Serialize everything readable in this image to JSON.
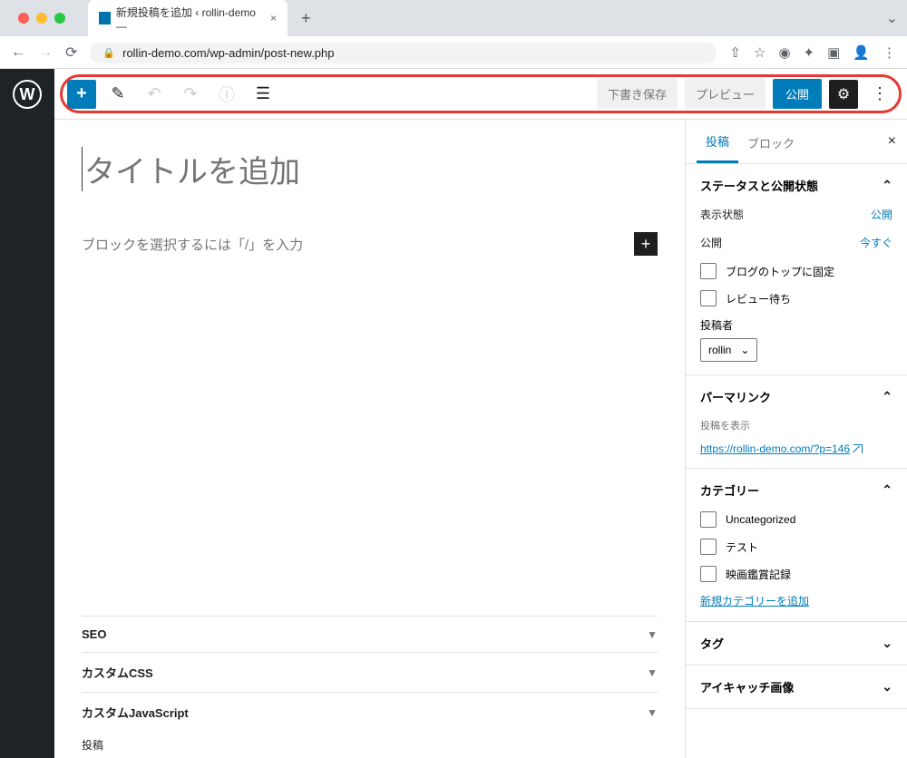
{
  "browser": {
    "tab_title": "新規投稿を追加 ‹ rollin-demo —",
    "url": "rollin-demo.com/wp-admin/post-new.php"
  },
  "toolbar": {
    "save_draft": "下書き保存",
    "preview": "プレビュー",
    "publish": "公開"
  },
  "editor": {
    "title_placeholder": "タイトルを追加",
    "block_placeholder": "ブロックを選択するには「/」を入力",
    "meta_panels": [
      "SEO",
      "カスタムCSS",
      "カスタムJavaScript"
    ],
    "footer": "投稿"
  },
  "sidebar": {
    "tabs": {
      "post": "投稿",
      "block": "ブロック"
    },
    "status": {
      "title": "ステータスと公開状態",
      "visibility_label": "表示状態",
      "visibility_value": "公開",
      "publish_label": "公開",
      "publish_value": "今すぐ",
      "sticky": "ブログのトップに固定",
      "pending": "レビュー待ち",
      "author_label": "投稿者",
      "author_value": "rollin"
    },
    "permalink": {
      "title": "パーマリンク",
      "view_post": "投稿を表示",
      "url": "https://rollin-demo.com/?p=146"
    },
    "categories": {
      "title": "カテゴリー",
      "items": [
        "Uncategorized",
        "テスト",
        "映画鑑賞記録"
      ],
      "add_new": "新規カテゴリーを追加"
    },
    "tags": {
      "title": "タグ"
    },
    "featured": {
      "title": "アイキャッチ画像"
    }
  }
}
